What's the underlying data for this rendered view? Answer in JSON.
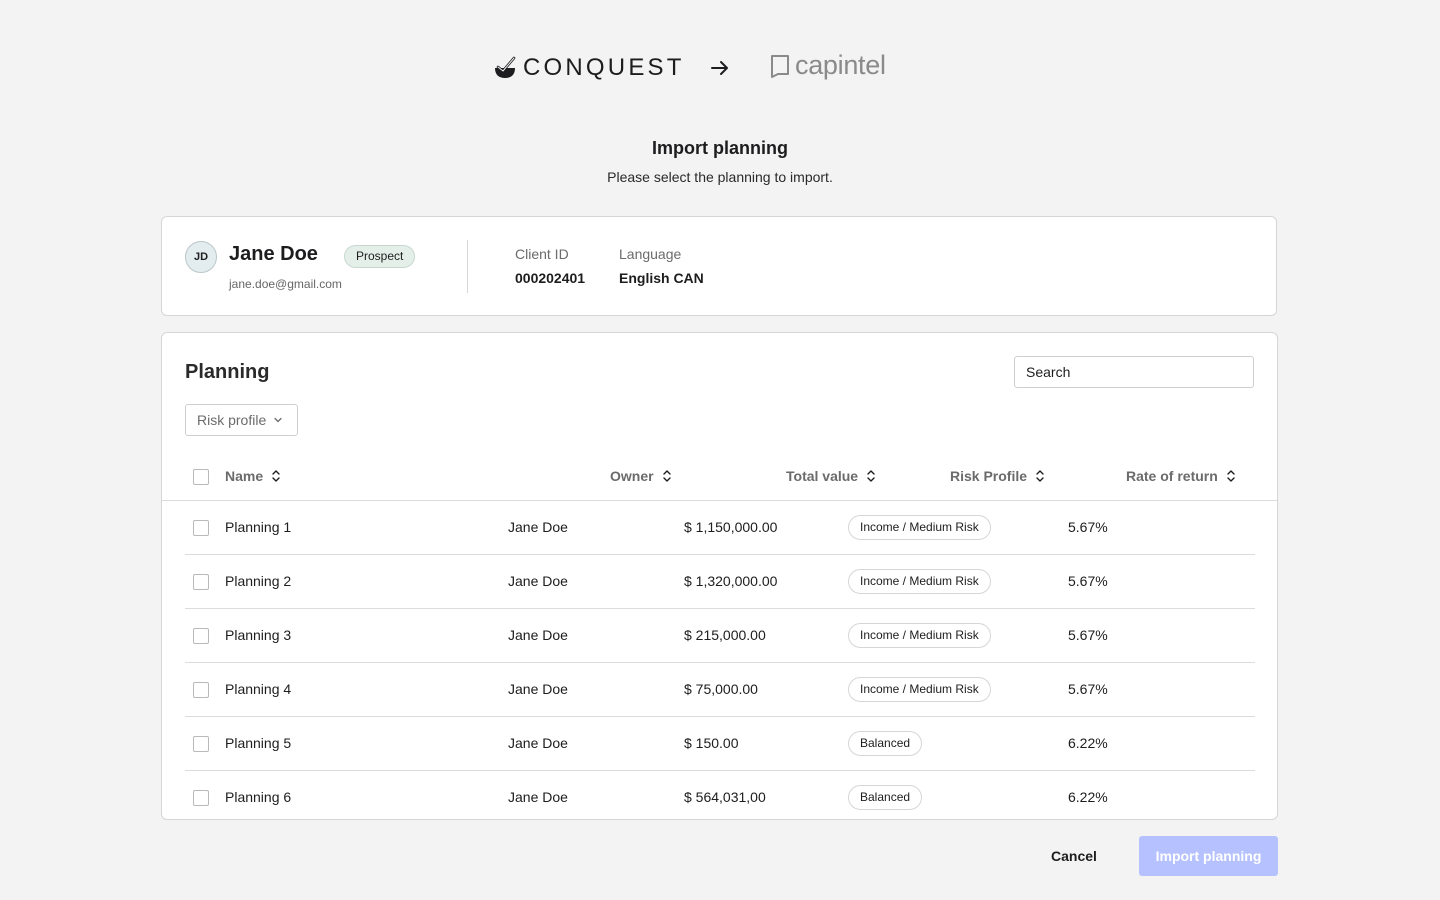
{
  "header": {
    "source_logo_text": "CONQUEST",
    "target_logo_text": "capintel",
    "title": "Import planning",
    "subtitle": "Please select the planning to import."
  },
  "client": {
    "initials": "JD",
    "name": "Jane Doe",
    "status": "Prospect",
    "email": "jane.doe@gmail.com",
    "client_id_label": "Client ID",
    "client_id_value": "000202401",
    "language_label": "Language",
    "language_value": "English CAN"
  },
  "planning": {
    "heading": "Planning",
    "search_placeholder": "Search",
    "filter_label": "Risk profile",
    "columns": {
      "name": "Name",
      "owner": "Owner",
      "total_value": "Total value",
      "risk_profile": "Risk Profile",
      "rate_of_return": "Rate of return"
    },
    "rows": [
      {
        "name": "Planning 1",
        "owner": "Jane Doe",
        "total_value": "$ 1,150,000.00",
        "risk": "Income / Medium Risk",
        "rate": "5.67%"
      },
      {
        "name": "Planning 2",
        "owner": "Jane Doe",
        "total_value": "$ 1,320,000.00",
        "risk": "Income / Medium Risk",
        "rate": "5.67%"
      },
      {
        "name": "Planning 3",
        "owner": "Jane Doe",
        "total_value": "$ 215,000.00",
        "risk": "Income / Medium Risk",
        "rate": "5.67%"
      },
      {
        "name": "Planning 4",
        "owner": "Jane Doe",
        "total_value": "$ 75,000.00",
        "risk": "Income / Medium Risk",
        "rate": "5.67%"
      },
      {
        "name": "Planning 5",
        "owner": "Jane Doe",
        "total_value": "$ 150.00",
        "risk": "Balanced",
        "rate": "6.22%"
      },
      {
        "name": "Planning 6",
        "owner": "Jane Doe",
        "total_value": "$ 564,031,00",
        "risk": "Balanced",
        "rate": "6.22%"
      }
    ]
  },
  "footer": {
    "cancel_label": "Cancel",
    "import_label": "Import planning"
  },
  "colors": {
    "primary_disabled": "#b6c2ff",
    "prospect_badge_bg": "#e4efea",
    "avatar_bg": "#e3ecee"
  }
}
